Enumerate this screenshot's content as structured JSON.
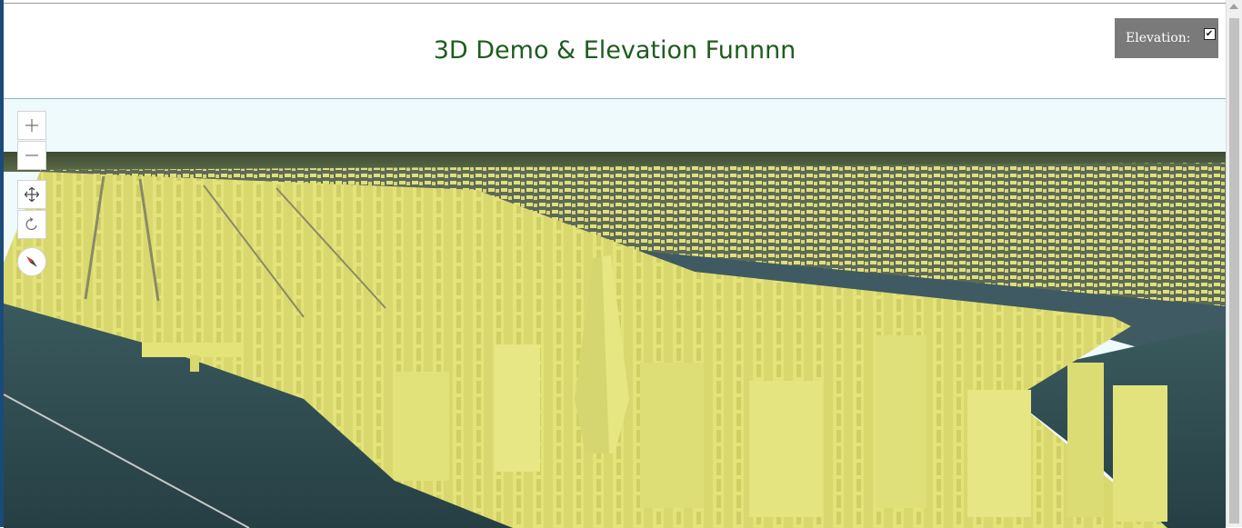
{
  "header": {
    "title": "3D Demo & Elevation Funnnn"
  },
  "elevation_toggle": {
    "label": "Elevation:",
    "checked": true,
    "check_glyph": "✔"
  },
  "map_controls": {
    "zoom_in_icon": "plus-icon",
    "zoom_out_icon": "minus-icon",
    "pan_icon": "move-arrows-icon",
    "rotate_icon": "rotate-icon",
    "compass_icon": "compass-icon"
  },
  "scene": {
    "description_colors": {
      "buildings": "#e5e57e",
      "water": "#2c4a4f",
      "sky": "#eefafc",
      "horizon": "#4a5b3a",
      "accent_title": "#1e5c1e",
      "panel_bg": "#7a7a7a"
    }
  }
}
